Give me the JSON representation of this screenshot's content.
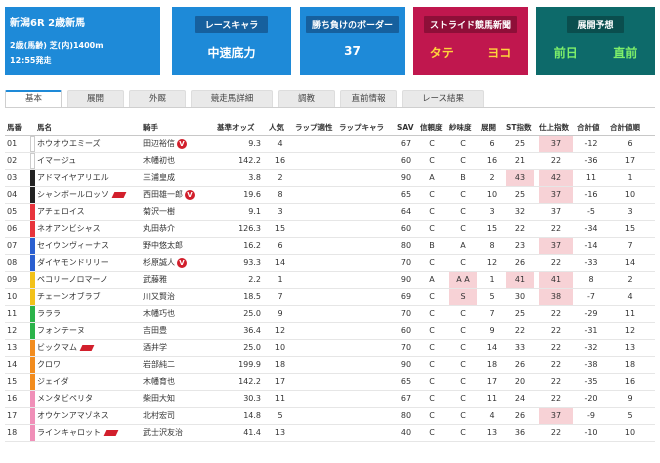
{
  "race": {
    "title": "新潟6R 2歳新馬",
    "condition": "2歳(馬齢) 芝(内)1400m",
    "start": "12:55発走"
  },
  "chara": {
    "label": "レースキャラ",
    "value": "中速底力"
  },
  "border": {
    "label": "勝ち負けのボーダー",
    "value": "37"
  },
  "stride": {
    "label": "ストライド競馬新聞",
    "v1": "タテ",
    "v2": "ヨコ"
  },
  "tenkai": {
    "label": "展開予想",
    "v1": "前日",
    "v2": "直前"
  },
  "tabs": [
    "基本",
    "展開",
    "外厩",
    "競走馬詳細",
    "調教",
    "直前情報",
    "レース結果"
  ],
  "columns": [
    "馬番",
    "馬名",
    "騎手",
    "基準オッズ",
    "人気",
    "ラップ適性",
    "ラップキャラ",
    "SAV",
    "信頼度",
    "紗味度",
    "展開",
    "ST指数",
    "仕上指数",
    "合計値",
    "合計値順"
  ],
  "colors": {
    "blue": "#1e8ad8",
    "crimson": "#c0174e",
    "teal": "#0d6a6a",
    "highlight": "#f7d2d6",
    "flag": "#d21f2c"
  },
  "rows": [
    {
      "no": "01",
      "name": "ホウオウエミーズ",
      "jockey": "田辺裕信",
      "odds": "9.3",
      "pop": "4",
      "sav": "67",
      "conf": "C",
      "sami": "C",
      "dev": "6",
      "st": "25",
      "fin": "37",
      "total": "-12",
      "rank": "6",
      "frame": "#ffffff",
      "flag": false,
      "v": true,
      "hl": [
        "fin"
      ]
    },
    {
      "no": "02",
      "name": "イマージュ",
      "jockey": "木幡初也",
      "odds": "142.2",
      "pop": "16",
      "sav": "60",
      "conf": "C",
      "sami": "C",
      "dev": "16",
      "st": "21",
      "fin": "22",
      "total": "-36",
      "rank": "17",
      "frame": "#ffffff",
      "flag": false,
      "v": false,
      "hl": []
    },
    {
      "no": "03",
      "name": "アドマイヤアリエル",
      "jockey": "三浦皇成",
      "odds": "3.8",
      "pop": "2",
      "sav": "90",
      "conf": "A",
      "sami": "B",
      "dev": "2",
      "st": "43",
      "fin": "42",
      "total": "11",
      "rank": "1",
      "frame": "#222222",
      "flag": false,
      "v": false,
      "hl": [
        "st",
        "fin"
      ]
    },
    {
      "no": "04",
      "name": "シャンボールロッソ",
      "jockey": "西田雄一郎",
      "odds": "19.6",
      "pop": "8",
      "sav": "65",
      "conf": "C",
      "sami": "C",
      "dev": "10",
      "st": "25",
      "fin": "37",
      "total": "-16",
      "rank": "10",
      "frame": "#222222",
      "flag": true,
      "v": true,
      "hl": [
        "fin"
      ]
    },
    {
      "no": "05",
      "name": "アチェロイス",
      "jockey": "菊沢一樹",
      "odds": "9.1",
      "pop": "3",
      "sav": "64",
      "conf": "C",
      "sami": "C",
      "dev": "3",
      "st": "32",
      "fin": "37",
      "total": "-5",
      "rank": "3",
      "frame": "#e8343c",
      "flag": false,
      "v": false,
      "hl": []
    },
    {
      "no": "06",
      "name": "ネオアンビシャス",
      "jockey": "丸田恭介",
      "odds": "126.3",
      "pop": "15",
      "sav": "60",
      "conf": "C",
      "sami": "C",
      "dev": "15",
      "st": "22",
      "fin": "22",
      "total": "-34",
      "rank": "15",
      "frame": "#e8343c",
      "flag": false,
      "v": false,
      "hl": []
    },
    {
      "no": "07",
      "name": "セイウンヴィーナス",
      "jockey": "野中悠太郎",
      "odds": "16.2",
      "pop": "6",
      "sav": "80",
      "conf": "B",
      "sami": "A",
      "dev": "8",
      "st": "23",
      "fin": "37",
      "total": "-14",
      "rank": "7",
      "frame": "#2a5fd0",
      "flag": false,
      "v": false,
      "hl": [
        "fin"
      ]
    },
    {
      "no": "08",
      "name": "ダイヤモンドリリー",
      "jockey": "杉原誠人",
      "odds": "93.3",
      "pop": "14",
      "sav": "70",
      "conf": "C",
      "sami": "C",
      "dev": "12",
      "st": "26",
      "fin": "22",
      "total": "-33",
      "rank": "14",
      "frame": "#2a5fd0",
      "flag": false,
      "v": true,
      "hl": []
    },
    {
      "no": "09",
      "name": "ペコリーノロマーノ",
      "jockey": "武藤雅",
      "odds": "2.2",
      "pop": "1",
      "sav": "90",
      "conf": "A",
      "sami": "A A",
      "dev": "1",
      "st": "41",
      "fin": "41",
      "total": "8",
      "rank": "2",
      "frame": "#f2c21b",
      "flag": false,
      "v": false,
      "hl": [
        "sami",
        "st",
        "fin"
      ]
    },
    {
      "no": "10",
      "name": "チェーンオブラブ",
      "jockey": "川又賢治",
      "odds": "18.5",
      "pop": "7",
      "sav": "69",
      "conf": "C",
      "sami": "S",
      "dev": "5",
      "st": "30",
      "fin": "38",
      "total": "-7",
      "rank": "4",
      "frame": "#f2c21b",
      "flag": false,
      "v": false,
      "hl": [
        "sami",
        "fin"
      ]
    },
    {
      "no": "11",
      "name": "ラララ",
      "jockey": "木幡巧也",
      "odds": "25.0",
      "pop": "9",
      "sav": "70",
      "conf": "C",
      "sami": "C",
      "dev": "7",
      "st": "25",
      "fin": "22",
      "total": "-29",
      "rank": "11",
      "frame": "#2bb34a",
      "flag": false,
      "v": false,
      "hl": []
    },
    {
      "no": "12",
      "name": "フォンテーヌ",
      "jockey": "吉田豊",
      "odds": "36.4",
      "pop": "12",
      "sav": "60",
      "conf": "C",
      "sami": "C",
      "dev": "9",
      "st": "22",
      "fin": "22",
      "total": "-31",
      "rank": "12",
      "frame": "#2bb34a",
      "flag": false,
      "v": false,
      "hl": []
    },
    {
      "no": "13",
      "name": "ビックマム",
      "jockey": "酒井学",
      "odds": "25.0",
      "pop": "10",
      "sav": "70",
      "conf": "C",
      "sami": "C",
      "dev": "14",
      "st": "33",
      "fin": "22",
      "total": "-32",
      "rank": "13",
      "frame": "#f28c1e",
      "flag": true,
      "v": false,
      "hl": []
    },
    {
      "no": "14",
      "name": "クロワ",
      "jockey": "岩部純二",
      "odds": "199.9",
      "pop": "18",
      "sav": "90",
      "conf": "C",
      "sami": "C",
      "dev": "18",
      "st": "26",
      "fin": "22",
      "total": "-38",
      "rank": "18",
      "frame": "#f28c1e",
      "flag": false,
      "v": false,
      "hl": []
    },
    {
      "no": "15",
      "name": "ジェイダ",
      "jockey": "木幡育也",
      "odds": "142.2",
      "pop": "17",
      "sav": "65",
      "conf": "C",
      "sami": "C",
      "dev": "17",
      "st": "20",
      "fin": "22",
      "total": "-35",
      "rank": "16",
      "frame": "#f28c1e",
      "flag": false,
      "v": false,
      "hl": []
    },
    {
      "no": "16",
      "name": "メンタビペリタ",
      "jockey": "柴田大知",
      "odds": "30.3",
      "pop": "11",
      "sav": "67",
      "conf": "C",
      "sami": "C",
      "dev": "11",
      "st": "24",
      "fin": "22",
      "total": "-20",
      "rank": "9",
      "frame": "#f08fb8",
      "flag": false,
      "v": false,
      "hl": []
    },
    {
      "no": "17",
      "name": "オウケンアマゾネス",
      "jockey": "北村宏司",
      "odds": "14.8",
      "pop": "5",
      "sav": "80",
      "conf": "C",
      "sami": "C",
      "dev": "4",
      "st": "26",
      "fin": "37",
      "total": "-9",
      "rank": "5",
      "frame": "#f08fb8",
      "flag": false,
      "v": false,
      "hl": [
        "fin"
      ]
    },
    {
      "no": "18",
      "name": "ラインキャロット",
      "jockey": "武士沢友治",
      "odds": "41.4",
      "pop": "13",
      "sav": "40",
      "conf": "C",
      "sami": "C",
      "dev": "13",
      "st": "36",
      "fin": "22",
      "total": "-10",
      "rank": "10",
      "frame": "#f08fb8",
      "flag": true,
      "v": false,
      "hl": []
    }
  ]
}
